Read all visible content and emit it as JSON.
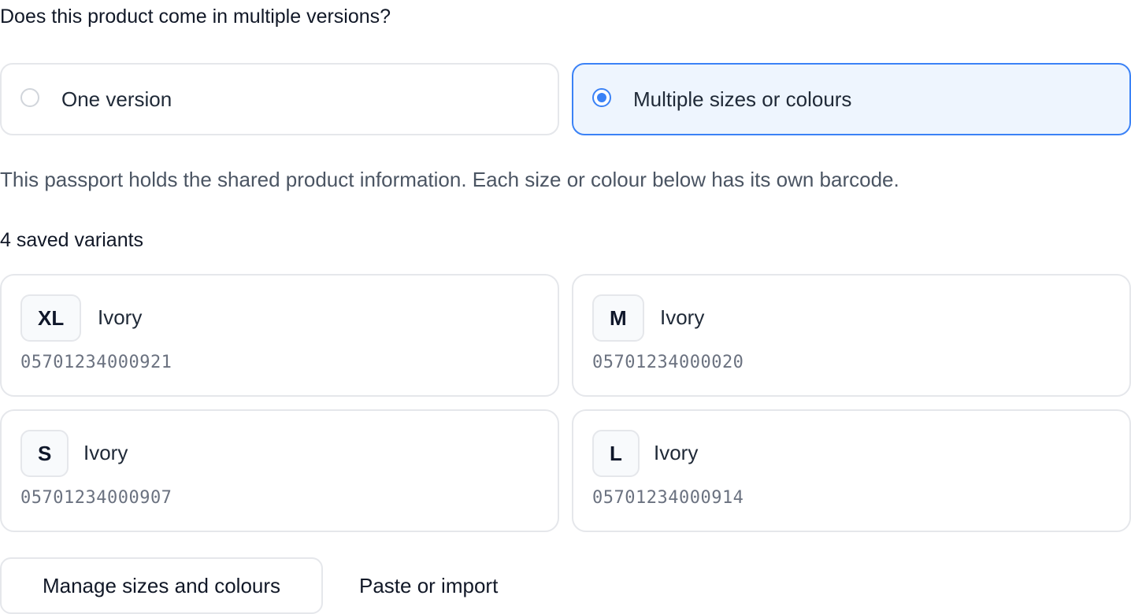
{
  "question": "Does this product come in multiple versions?",
  "options": [
    {
      "label": "One version",
      "selected": false
    },
    {
      "label": "Multiple sizes or colours",
      "selected": true
    }
  ],
  "helper_text": "This passport holds the shared product information. Each size or colour below has its own barcode.",
  "variants_heading": "4 saved variants",
  "variants": [
    {
      "size": "XL",
      "colour": "Ivory",
      "barcode": "05701234000921"
    },
    {
      "size": "M",
      "colour": "Ivory",
      "barcode": "05701234000020"
    },
    {
      "size": "S",
      "colour": "Ivory",
      "barcode": "05701234000907"
    },
    {
      "size": "L",
      "colour": "Ivory",
      "barcode": "05701234000914"
    }
  ],
  "actions": {
    "manage_label": "Manage sizes and colours",
    "paste_label": "Paste or import"
  },
  "colors": {
    "accent": "#3b82f6",
    "selected_bg": "#eef5fe",
    "border": "#e5e7eb"
  }
}
